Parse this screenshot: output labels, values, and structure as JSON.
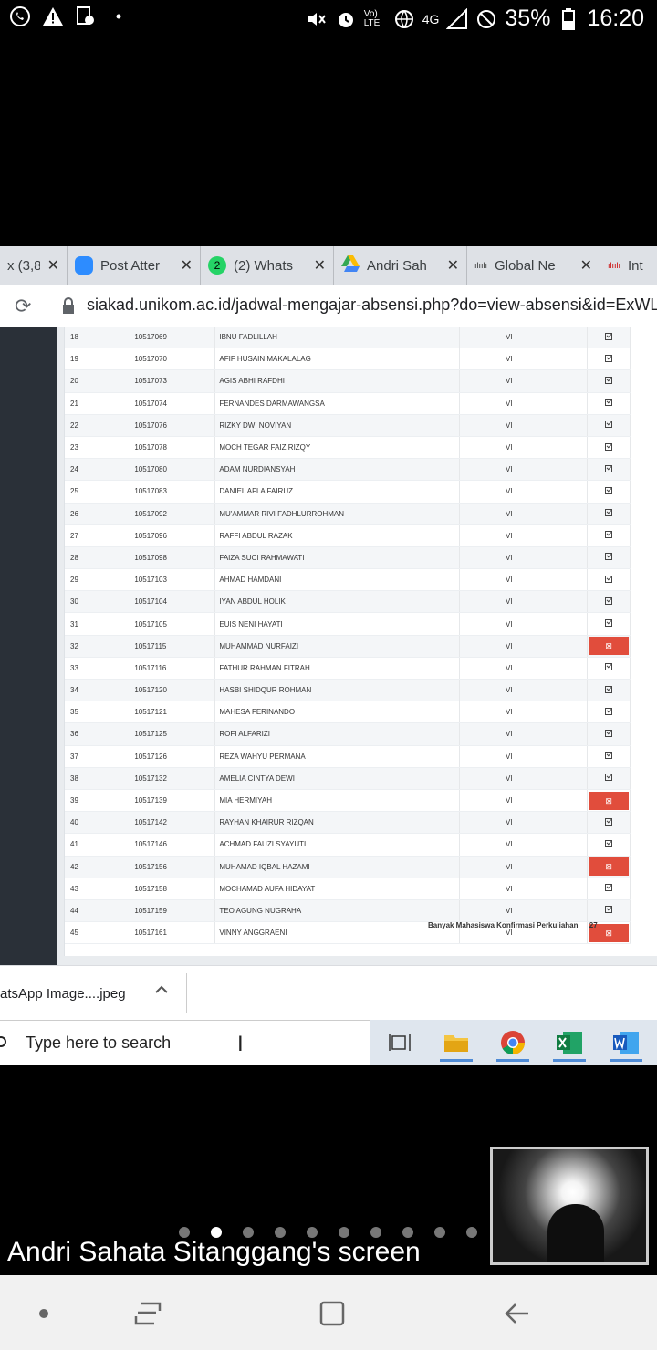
{
  "status_bar": {
    "battery_percent": "35%",
    "clock": "16:20",
    "network": "4G",
    "volte": "Vo) LTE"
  },
  "browser": {
    "tabs": [
      {
        "title": "x (3,8",
        "icon": "mail-icon"
      },
      {
        "title": "Post Atter",
        "icon": "zoom-icon"
      },
      {
        "title": "(2) Whats",
        "icon": "whatsapp-icon",
        "badge": "2"
      },
      {
        "title": "Andri Sah",
        "icon": "google-drive-icon"
      },
      {
        "title": "Global Ne",
        "icon": "cisco-icon"
      },
      {
        "title": "Int",
        "icon": "cisco-icon"
      }
    ],
    "url": "siakad.unikom.ac.id/jadwal-mengajar-absensi.php?do=view-absensi&id=ExWLkb"
  },
  "attendance": {
    "rows": [
      {
        "no": "18",
        "nim": "10517069",
        "name": "IBNU FADLILLAH",
        "sem": "VI",
        "present": true
      },
      {
        "no": "19",
        "nim": "10517070",
        "name": "AFIF HUSAIN MAKALALAG",
        "sem": "VI",
        "present": true
      },
      {
        "no": "20",
        "nim": "10517073",
        "name": "AGIS ABHI RAFDHI",
        "sem": "VI",
        "present": true
      },
      {
        "no": "21",
        "nim": "10517074",
        "name": "FERNANDES DARMAWANGSA",
        "sem": "VI",
        "present": true
      },
      {
        "no": "22",
        "nim": "10517076",
        "name": "RIZKY DWI NOVIYAN",
        "sem": "VI",
        "present": true
      },
      {
        "no": "23",
        "nim": "10517078",
        "name": "MOCH TEGAR FAIZ RIZQY",
        "sem": "VI",
        "present": true
      },
      {
        "no": "24",
        "nim": "10517080",
        "name": "ADAM NURDIANSYAH",
        "sem": "VI",
        "present": true
      },
      {
        "no": "25",
        "nim": "10517083",
        "name": "DANIEL AFLA FAIRUZ",
        "sem": "VI",
        "present": true
      },
      {
        "no": "26",
        "nim": "10517092",
        "name": "MU'AMMAR RIVI FADHLURROHMAN",
        "sem": "VI",
        "present": true
      },
      {
        "no": "27",
        "nim": "10517096",
        "name": "RAFFI ABDUL RAZAK",
        "sem": "VI",
        "present": true
      },
      {
        "no": "28",
        "nim": "10517098",
        "name": "FAIZA SUCI RAHMAWATI",
        "sem": "VI",
        "present": true
      },
      {
        "no": "29",
        "nim": "10517103",
        "name": "AHMAD HAMDANI",
        "sem": "VI",
        "present": true
      },
      {
        "no": "30",
        "nim": "10517104",
        "name": "IYAN ABDUL HOLIK",
        "sem": "VI",
        "present": true
      },
      {
        "no": "31",
        "nim": "10517105",
        "name": "EUIS NENI HAYATI",
        "sem": "VI",
        "present": true
      },
      {
        "no": "32",
        "nim": "10517115",
        "name": "MUHAMMAD NURFAIZI",
        "sem": "VI",
        "present": false
      },
      {
        "no": "33",
        "nim": "10517116",
        "name": "FATHUR RAHMAN FITRAH",
        "sem": "VI",
        "present": true
      },
      {
        "no": "34",
        "nim": "10517120",
        "name": "HASBI SHIDQUR ROHMAN",
        "sem": "VI",
        "present": true
      },
      {
        "no": "35",
        "nim": "10517121",
        "name": "MAHESA FERINANDO",
        "sem": "VI",
        "present": true
      },
      {
        "no": "36",
        "nim": "10517125",
        "name": "ROFI ALFARIZI",
        "sem": "VI",
        "present": true
      },
      {
        "no": "37",
        "nim": "10517126",
        "name": "REZA WAHYU PERMANA",
        "sem": "VI",
        "present": true
      },
      {
        "no": "38",
        "nim": "10517132",
        "name": "AMELIA CINTYA DEWI",
        "sem": "VI",
        "present": true
      },
      {
        "no": "39",
        "nim": "10517139",
        "name": "MIA HERMIYAH",
        "sem": "VI",
        "present": false
      },
      {
        "no": "40",
        "nim": "10517142",
        "name": "RAYHAN KHAIRUR RIZQAN",
        "sem": "VI",
        "present": true
      },
      {
        "no": "41",
        "nim": "10517146",
        "name": "ACHMAD FAUZI SYAYUTI",
        "sem": "VI",
        "present": true
      },
      {
        "no": "42",
        "nim": "10517156",
        "name": "MUHAMAD IQBAL HAZAMI",
        "sem": "VI",
        "present": false
      },
      {
        "no": "43",
        "nim": "10517158",
        "name": "MOCHAMAD AUFA HIDAYAT",
        "sem": "VI",
        "present": true
      },
      {
        "no": "44",
        "nim": "10517159",
        "name": "TEO AGUNG NUGRAHA",
        "sem": "VI",
        "present": true
      },
      {
        "no": "45",
        "nim": "10517161",
        "name": "VINNY ANGGRAENI",
        "sem": "VI",
        "present": false
      }
    ],
    "summary_label": "Banyak Mahasiswa Konfirmasi Perkuliahan",
    "summary_count": "27"
  },
  "downloads": {
    "file_name": "atsApp Image....jpeg"
  },
  "taskbar": {
    "search_placeholder": "Type here to search",
    "apps": [
      "task-view-icon",
      "file-explorer-icon",
      "chrome-icon",
      "excel-icon",
      "word-icon"
    ]
  },
  "screen_share": {
    "caption": "Andri Sahata Sitanggang's screen",
    "page_count": 10,
    "active_page": 2
  },
  "colors": {
    "absent": "#e14d3c",
    "sidebar": "#2a3038",
    "taskbar": "#dfe6ee"
  }
}
